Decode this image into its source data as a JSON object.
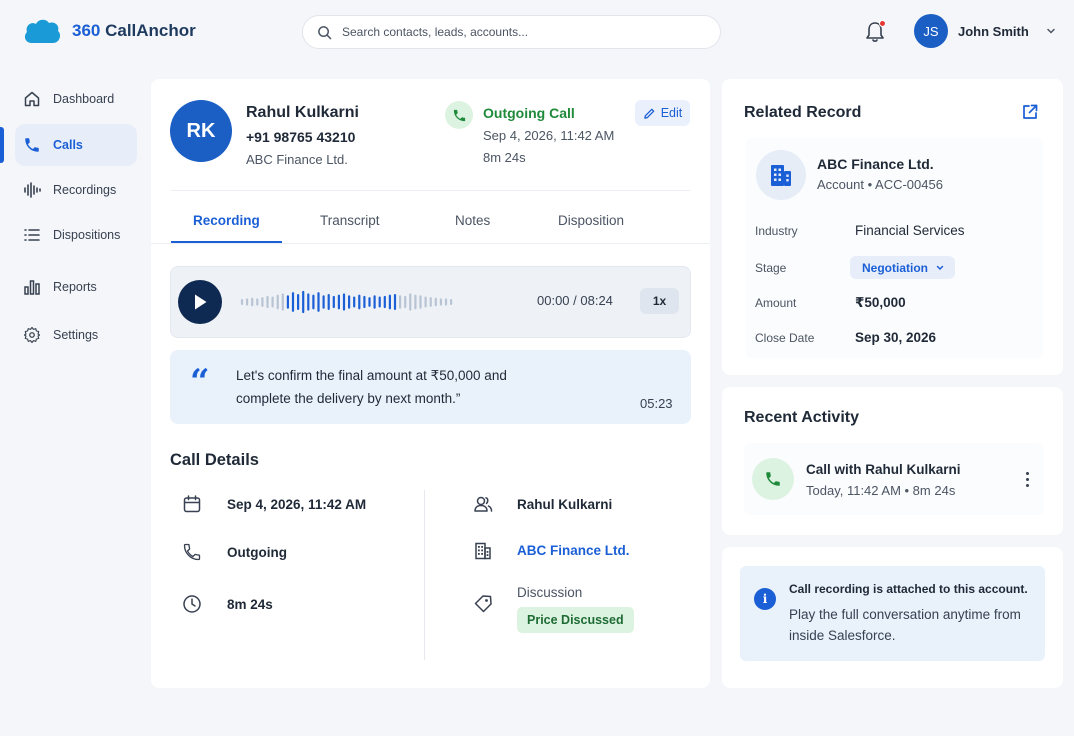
{
  "app": {
    "name_prefix": "360",
    "name_rest": " CallAnchor"
  },
  "search": {
    "placeholder": "Search contacts, leads, accounts..."
  },
  "user": {
    "initials": "JS",
    "name": "John Smith"
  },
  "sidebar": {
    "items": [
      {
        "label": "Dashboard",
        "icon": "home-icon"
      },
      {
        "label": "Calls",
        "icon": "phone-icon",
        "active": true
      },
      {
        "label": "Recordings",
        "icon": "waveform-icon"
      },
      {
        "label": "Dispositions",
        "icon": "list-icon"
      },
      {
        "label": "Reports",
        "icon": "bar-chart-icon"
      },
      {
        "label": "Settings",
        "icon": "gear-icon"
      }
    ]
  },
  "call": {
    "initials": "RK",
    "name": "Rahul Kulkarni",
    "phone": "+91 98765 43210",
    "company": "ABC Finance Ltd.",
    "type": "Outgoing Call",
    "datetime": "Sep 4, 2026, 11:42 AM",
    "duration": "8m 24s",
    "edit_label": "Edit"
  },
  "tabs": [
    "Recording",
    "Transcript",
    "Notes",
    "Disposition"
  ],
  "player": {
    "time": "00:00 / 08:24",
    "speed": "1x"
  },
  "quote": {
    "mark": "“",
    "text": "Let's confirm the final amount at ₹50,000 and complete the delivery by next month.”",
    "timestamp": "05:23"
  },
  "details": {
    "title": "Call Details",
    "date": "Sep 4, 2026, 11:42 AM",
    "direction": "Outgoing",
    "duration": "8m 24s",
    "contact": "Rahul Kulkarni",
    "account": "ABC Finance Ltd.",
    "disposition_label": "Discussion",
    "disposition_badge": "Price Discussed"
  },
  "related": {
    "title": "Related Record",
    "account_name": "ABC Finance Ltd.",
    "account_sub": "Account • ACC-00456",
    "fields": {
      "industry_label": "Industry",
      "industry": "Financial Services",
      "stage_label": "Stage",
      "stage": "Negotiation",
      "amount_label": "Amount",
      "amount": "₹50,000",
      "close_label": "Close Date",
      "close": "Sep 30, 2026"
    }
  },
  "activity": {
    "title": "Recent Activity",
    "item_title": "Call with Rahul Kulkarni",
    "item_sub": "Today, 11:42 AM • 8m 24s"
  },
  "info": {
    "title": "Call recording is attached to this account.",
    "text": "Play the full conversation anytime from inside Salesforce."
  },
  "colors": {
    "accent": "#1b5fd6",
    "navy": "#0f2a52",
    "success": "#1f8a3a",
    "notification": "#e53935"
  }
}
